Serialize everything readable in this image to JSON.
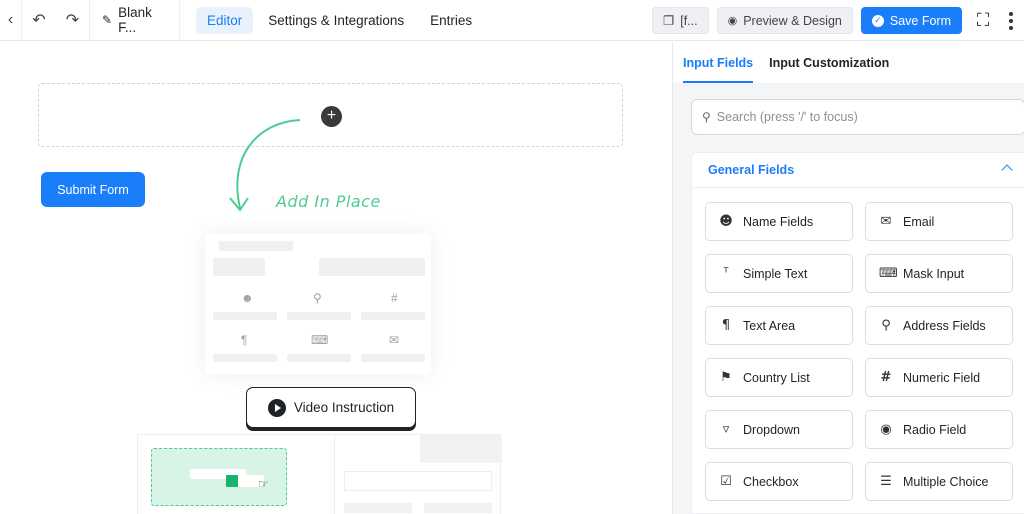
{
  "header": {
    "form_title": "Blank F...",
    "nav": [
      {
        "label": "Editor",
        "active": true
      },
      {
        "label": "Settings & Integrations",
        "active": false
      },
      {
        "label": "Entries",
        "active": false
      }
    ],
    "shortcode_label": "[f...",
    "preview_label": "Preview & Design",
    "save_label": "Save Form",
    "accent_color": "#1a7efb"
  },
  "canvas": {
    "submit_label": "Submit Form",
    "add_in_place_label": "Add In Place",
    "video_label": "Video Instruction"
  },
  "sidebar": {
    "tabs": [
      {
        "label": "Input Fields",
        "active": true
      },
      {
        "label": "Input Customization",
        "active": false
      }
    ],
    "search_placeholder": "Search (press '/' to focus)",
    "section_title": "General Fields",
    "fields": [
      {
        "label": "Name Fields",
        "icon": "user-icon"
      },
      {
        "label": "Email",
        "icon": "envelope-icon"
      },
      {
        "label": "Simple Text",
        "icon": "text-cursor-icon"
      },
      {
        "label": "Mask Input",
        "icon": "keyboard-icon"
      },
      {
        "label": "Text Area",
        "icon": "paragraph-icon"
      },
      {
        "label": "Address Fields",
        "icon": "map-pin-icon"
      },
      {
        "label": "Country List",
        "icon": "flag-icon"
      },
      {
        "label": "Numeric Field",
        "icon": "hash-icon"
      },
      {
        "label": "Dropdown",
        "icon": "dropdown-icon"
      },
      {
        "label": "Radio Field",
        "icon": "radio-icon"
      },
      {
        "label": "Checkbox",
        "icon": "checkbox-icon"
      },
      {
        "label": "Multiple Choice",
        "icon": "list-icon"
      }
    ]
  }
}
